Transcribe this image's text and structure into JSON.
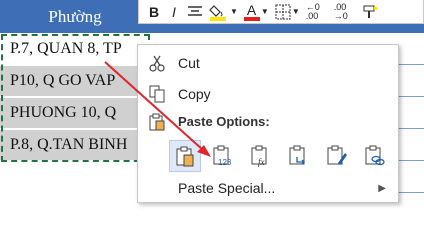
{
  "sheet": {
    "column_header": "Phường",
    "rows": [
      "P.7, QUAN 8, TP",
      "P10, Q GO VAP",
      "PHUONG 10, Q",
      "P.8, Q.TAN BINH"
    ]
  },
  "toolbar": {
    "buttons": [
      "bold",
      "italic",
      "align-center",
      "fill-color",
      "font-color",
      "borders",
      "increase-decimal",
      "decrease-decimal",
      "format-painter"
    ],
    "bold_label": "B",
    "italic_label": "I",
    "font_color_label": "A",
    "inc_decimal_label": "←0 .00",
    "dec_decimal_label": ".00 →0"
  },
  "context_menu": {
    "cut": "Cut",
    "copy": "Copy",
    "paste_options": "Paste Options:",
    "paste_buttons": [
      "paste",
      "paste-values",
      "paste-formulas",
      "transpose",
      "paste-formatting",
      "paste-link"
    ],
    "paste_special": "Paste Special..."
  },
  "colors": {
    "header_blue": "#3e6fb6",
    "selection_green": "#217346",
    "fill_yellow": "#ffe600",
    "font_red": "#e02020",
    "arrow_red": "#e0262a"
  }
}
